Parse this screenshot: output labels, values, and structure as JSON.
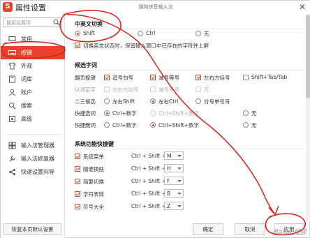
{
  "app": {
    "title": "属性设置",
    "window_center_title": "搜狗拼音输入法",
    "logo_letter": "S",
    "accent": "#e8442c"
  },
  "sidebar": {
    "search_placeholder": "搜索设置项",
    "items": [
      {
        "label": "常用",
        "icon": "monitor-icon"
      },
      {
        "label": "按键",
        "icon": "keyboard-icon",
        "active": true
      },
      {
        "label": "外观",
        "icon": "shirt-icon"
      },
      {
        "label": "词库",
        "icon": "book-icon"
      },
      {
        "label": "账户",
        "icon": "user-icon"
      },
      {
        "label": "搜索",
        "icon": "search-icon"
      },
      {
        "label": "高级",
        "icon": "gear-icon"
      }
    ],
    "tools": [
      {
        "label": "输入法管理器",
        "icon": "grid-icon"
      },
      {
        "label": "输入法修复器",
        "icon": "wrench-icon"
      },
      {
        "label": "快速设置向导",
        "icon": "share-icon"
      }
    ],
    "restore_label": "恢复本页默认设置"
  },
  "switch_section": {
    "title": "中英文切换",
    "options": [
      "Shift",
      "Ctrl",
      "无"
    ],
    "selected": 0,
    "commit_checkbox": "切换英文状态时，保留输入窗口中已存在的字符并上屏"
  },
  "candidate_section": {
    "title": "候选字词",
    "rows": [
      {
        "label": "翻页按键",
        "type": "check",
        "opts": [
          {
            "text": "逗号句号",
            "on": true
          },
          {
            "text": "减号等号",
            "on": true
          },
          {
            "text": "左右方括号",
            "on": true
          },
          {
            "text": "Shift+Tab/Tab",
            "on": false
          }
        ]
      },
      {
        "label": "以词定字",
        "type": "check",
        "dim": true,
        "opts": [
          {
            "text": "左右方括号",
            "on": false
          },
          {
            "text": "减号等号",
            "on": false
          },
          {
            "text": "无",
            "on": false
          }
        ]
      },
      {
        "label": "二三候选",
        "type": "radio",
        "selected": 1,
        "opts": [
          {
            "text": "左右Shift"
          },
          {
            "text": "左右Ctrl"
          },
          {
            "text": "分号单引号"
          }
        ]
      },
      {
        "label": "快捷选词",
        "type": "radio",
        "selected": 0,
        "opts": [
          {
            "text": "Ctrl+数字"
          },
          {
            "text": "Ctrl+Shift+数字",
            "dim": true
          },
          {
            "text": "无"
          }
        ]
      },
      {
        "label": "快捷删词",
        "type": "radio",
        "selected": 1,
        "opts": [
          {
            "text": "Ctrl+数字"
          },
          {
            "text": "Ctrl+Shift+数字"
          },
          {
            "text": "无"
          }
        ]
      }
    ]
  },
  "hotkey_section": {
    "title": "系统功能快捷键",
    "prefix": "Ctrl + Shift +",
    "items": [
      {
        "label": "系统菜单",
        "key": "M"
      },
      {
        "label": "随便换肤",
        "key": "H"
      },
      {
        "label": "简繁切换",
        "key": "F"
      },
      {
        "label": "字符表情",
        "key": "B"
      },
      {
        "label": "符号大全",
        "key": "Z"
      }
    ]
  },
  "footer": {
    "ok": "确定",
    "cancel": "取消",
    "apply": "应用"
  },
  "watermark": "Baidu 经验"
}
